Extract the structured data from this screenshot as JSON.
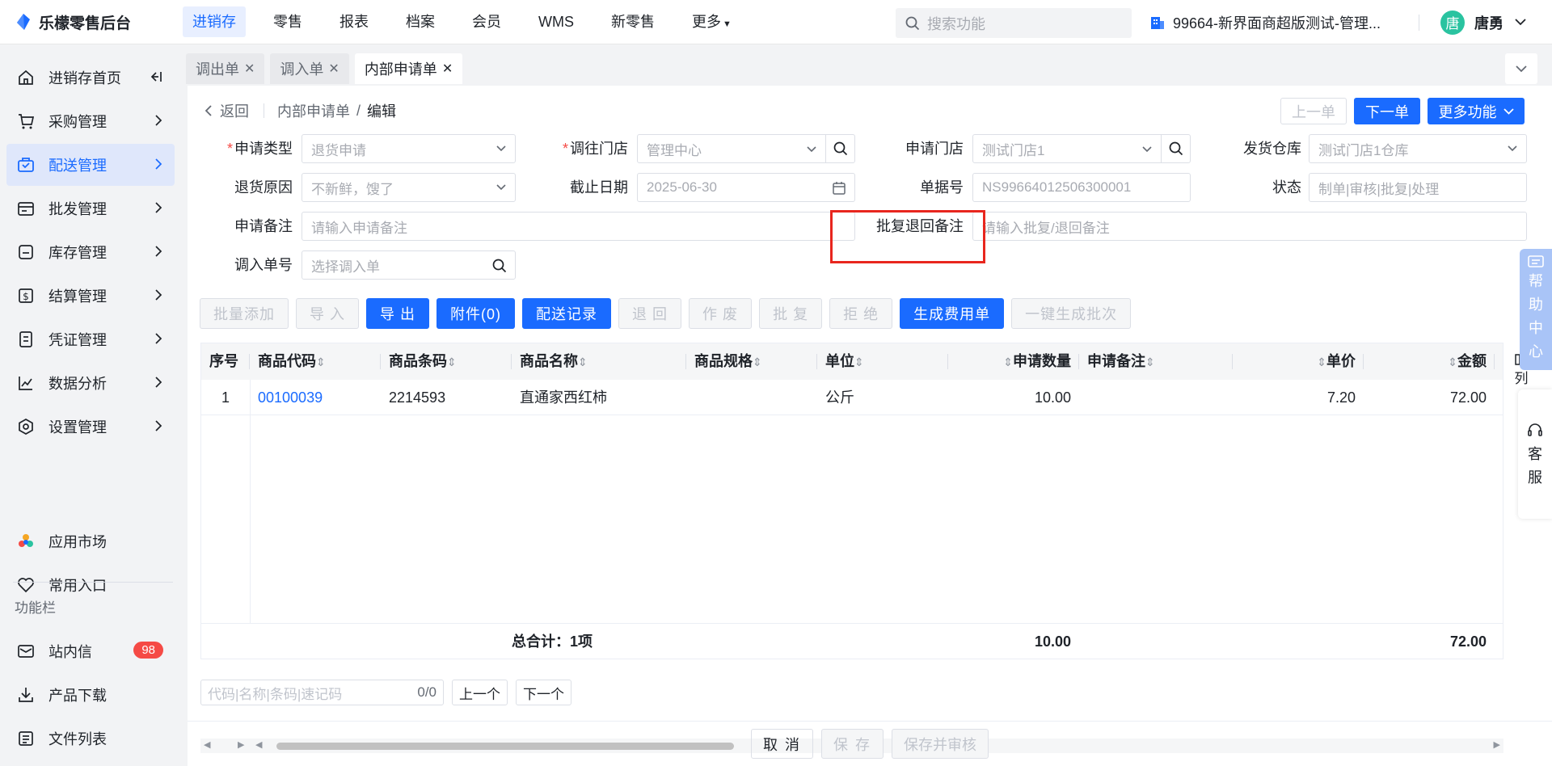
{
  "app": {
    "title": "乐檬零售后台"
  },
  "topnav": [
    {
      "label": "进销存",
      "active": true
    },
    {
      "label": "零售"
    },
    {
      "label": "报表"
    },
    {
      "label": "档案"
    },
    {
      "label": "会员"
    },
    {
      "label": "WMS"
    },
    {
      "label": "新零售"
    },
    {
      "label": "更多"
    }
  ],
  "search": {
    "placeholder": "搜索功能"
  },
  "store": {
    "label": "99664-新界面商超版测试-管理..."
  },
  "user": {
    "avatar": "唐",
    "name": "唐勇"
  },
  "sidebar": {
    "items": [
      {
        "label": "进销存首页",
        "icon": "home-icon"
      },
      {
        "label": "采购管理",
        "icon": "cart-icon"
      },
      {
        "label": "配送管理",
        "icon": "delivery-icon",
        "active": true
      },
      {
        "label": "批发管理",
        "icon": "wholesale-icon"
      },
      {
        "label": "库存管理",
        "icon": "inventory-icon"
      },
      {
        "label": "结算管理",
        "icon": "settlement-icon"
      },
      {
        "label": "凭证管理",
        "icon": "voucher-icon"
      },
      {
        "label": "数据分析",
        "icon": "chart-icon"
      },
      {
        "label": "设置管理",
        "icon": "settings-icon"
      }
    ],
    "extras": [
      {
        "label": "应用市场",
        "icon": "app-market-icon"
      },
      {
        "label": "常用入口",
        "icon": "heart-icon"
      }
    ],
    "section_title": "功能栏",
    "tools": [
      {
        "label": "站内信",
        "icon": "mail-icon",
        "badge": "98"
      },
      {
        "label": "产品下载",
        "icon": "download-icon"
      },
      {
        "label": "文件列表",
        "icon": "file-list-icon"
      }
    ]
  },
  "tabs": [
    {
      "label": "调出单",
      "active": false
    },
    {
      "label": "调入单",
      "active": false
    },
    {
      "label": "内部申请单",
      "active": true
    }
  ],
  "breadcrumb": {
    "back": "返回",
    "parent": "内部申请单",
    "sep": "/",
    "current": "编辑"
  },
  "header_buttons": {
    "prev": "上一单",
    "next": "下一单",
    "more": "更多功能"
  },
  "form": {
    "apply_type": {
      "label": "申请类型",
      "value": "退货申请"
    },
    "target_store": {
      "label": "调往门店",
      "value": "管理中心"
    },
    "apply_store": {
      "label": "申请门店",
      "value": "测试门店1"
    },
    "ship_warehouse": {
      "label": "发货仓库",
      "value": "测试门店1仓库"
    },
    "return_reason": {
      "label": "退货原因",
      "value": "不新鲜，馊了"
    },
    "deadline": {
      "label": "截止日期",
      "value": "2025-06-30"
    },
    "doc_no": {
      "label": "单据号",
      "value": "NS99664012506300001"
    },
    "status": {
      "label": "状态",
      "placeholder": "制单|审核|批复|处理"
    },
    "apply_note": {
      "label": "申请备注",
      "placeholder": "请输入申请备注"
    },
    "reply_note": {
      "label": "批复退回备注",
      "placeholder": "请输入批复/退回备注"
    },
    "transfer_in_no": {
      "label": "调入单号",
      "placeholder": "选择调入单"
    }
  },
  "toolbar": {
    "batch_add": "批量添加",
    "import": "导 入",
    "export": "导 出",
    "attachment": "附件(0)",
    "delivery_record": "配送记录",
    "return": "退 回",
    "void": "作 废",
    "approve": "批 复",
    "reject": "拒 绝",
    "gen_fee": "生成费用单",
    "gen_batch": "一键生成批次"
  },
  "table": {
    "headers": [
      "序号",
      "商品代码",
      "商品条码",
      "商品名称",
      "商品规格",
      "单位",
      "申请数量",
      "申请备注",
      "单价",
      "金额"
    ],
    "rows": [
      {
        "idx": "1",
        "code": "00100039",
        "barcode": "2214593",
        "name": "直通家西红柿",
        "spec": "",
        "unit": "公斤",
        "qty": "10.00",
        "note": "",
        "price": "7.20",
        "amount": "72.00"
      }
    ],
    "footer": {
      "label": "总合计：1项",
      "qty": "10.00",
      "amount": "72.00"
    },
    "column_settings": "列"
  },
  "find": {
    "placeholder": "代码|名称|条码|速记码",
    "count": "0/0",
    "prev": "上一个",
    "next": "下一个"
  },
  "bottom": {
    "cancel": "取 消",
    "save": "保 存",
    "save_audit": "保存并审核"
  },
  "float": {
    "help": [
      "帮",
      "助",
      "中",
      "心"
    ],
    "service": [
      "客",
      "服"
    ]
  },
  "colors": {
    "primary": "#1a6bff",
    "active_bg": "#dfe7fb",
    "highlight_box": "#e8261e",
    "badge": "#f54a45"
  }
}
